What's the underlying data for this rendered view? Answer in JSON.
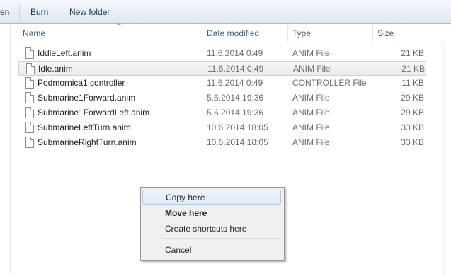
{
  "toolbar": {
    "items": [
      {
        "label": "en"
      },
      {
        "label": "Burn"
      },
      {
        "label": "New folder"
      }
    ]
  },
  "columns": {
    "name": "Name",
    "date": "Date modified",
    "type": "Type",
    "size": "Size"
  },
  "files": [
    {
      "name": "IddleLeft.anim",
      "date": "11.6.2014 0:49",
      "type": "ANIM File",
      "size": "21 KB",
      "selected": false
    },
    {
      "name": "Idle.anim",
      "date": "11.6.2014 0:49",
      "type": "ANIM File",
      "size": "21 KB",
      "selected": true
    },
    {
      "name": "Podmornica1.controller",
      "date": "11.6.2014 0:49",
      "type": "CONTROLLER File",
      "size": "11 KB",
      "selected": false
    },
    {
      "name": "Submarine1Forward.anim",
      "date": "5.6.2014 19:36",
      "type": "ANIM File",
      "size": "29 KB",
      "selected": false
    },
    {
      "name": "Submarine1ForwardLeft.anim",
      "date": "5.6.2014 19:36",
      "type": "ANIM File",
      "size": "29 KB",
      "selected": false
    },
    {
      "name": "SubmarineLeftTurn.anim",
      "date": "10.6.2014 18:05",
      "type": "ANIM File",
      "size": "33 KB",
      "selected": false
    },
    {
      "name": "SubmarineRightTurn.anim",
      "date": "10.6.2014 18:05",
      "type": "ANIM File",
      "size": "33 KB",
      "selected": false
    }
  ],
  "context_menu": {
    "items": [
      {
        "label": "Copy here",
        "highlighted": true,
        "bold": false
      },
      {
        "label": "Move here",
        "highlighted": false,
        "bold": true
      },
      {
        "label": "Create shortcuts here",
        "highlighted": false,
        "bold": false
      },
      {
        "label": "Cancel",
        "highlighted": false,
        "bold": false
      }
    ]
  },
  "colors": {
    "toolbar_text": "#1e395b",
    "header_text": "#4c607a",
    "secondary_text": "#6d6d6d",
    "menu_highlight_border": "#a8c8ee"
  }
}
